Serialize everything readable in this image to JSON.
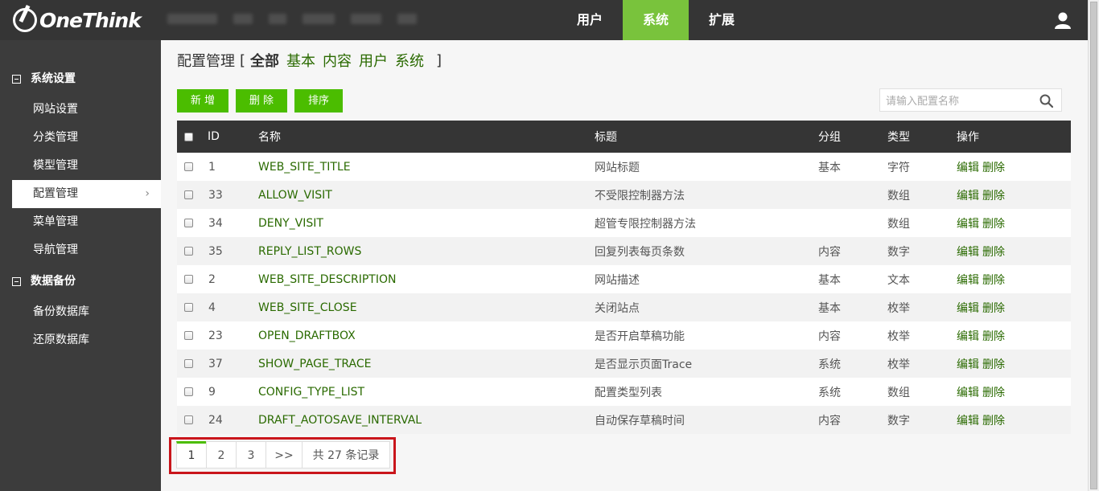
{
  "app": {
    "logo_text": "OneThink",
    "user_icon": "user-icon"
  },
  "top_nav": [
    {
      "label": "用户",
      "active": false
    },
    {
      "label": "系统",
      "active": true
    },
    {
      "label": "扩展",
      "active": false
    }
  ],
  "sidebar": {
    "groups": [
      {
        "title": "系统设置",
        "items": [
          {
            "label": "网站设置",
            "active": false
          },
          {
            "label": "分类管理",
            "active": false
          },
          {
            "label": "模型管理",
            "active": false
          },
          {
            "label": "配置管理",
            "active": true
          },
          {
            "label": "菜单管理",
            "active": false
          },
          {
            "label": "导航管理",
            "active": false
          }
        ]
      },
      {
        "title": "数据备份",
        "items": [
          {
            "label": "备份数据库",
            "active": false
          },
          {
            "label": "还原数据库",
            "active": false
          }
        ]
      }
    ]
  },
  "page": {
    "title": "配置管理",
    "open_bracket": "[",
    "close_bracket": "]",
    "filters": [
      {
        "label": "全部",
        "active": true
      },
      {
        "label": "基本",
        "active": false
      },
      {
        "label": "内容",
        "active": false
      },
      {
        "label": "用户",
        "active": false
      },
      {
        "label": "系统",
        "active": false
      }
    ]
  },
  "toolbar": {
    "add_label": "新 增",
    "delete_label": "删 除",
    "sort_label": "排序",
    "search_placeholder": "请输入配置名称",
    "accent_color": "#4bbd00"
  },
  "table": {
    "headers": {
      "id": "ID",
      "name": "名称",
      "title": "标题",
      "group": "分组",
      "type": "类型",
      "ops": "操作"
    },
    "rows": [
      {
        "id": "1",
        "name": "WEB_SITE_TITLE",
        "title": "网站标题",
        "group": "基本",
        "type": "字符"
      },
      {
        "id": "33",
        "name": "ALLOW_VISIT",
        "title": "不受限控制器方法",
        "group": "",
        "type": "数组"
      },
      {
        "id": "34",
        "name": "DENY_VISIT",
        "title": "超管专限控制器方法",
        "group": "",
        "type": "数组"
      },
      {
        "id": "35",
        "name": "REPLY_LIST_ROWS",
        "title": "回复列表每页条数",
        "group": "内容",
        "type": "数字"
      },
      {
        "id": "2",
        "name": "WEB_SITE_DESCRIPTION",
        "title": "网站描述",
        "group": "基本",
        "type": "文本"
      },
      {
        "id": "4",
        "name": "WEB_SITE_CLOSE",
        "title": "关闭站点",
        "group": "基本",
        "type": "枚举"
      },
      {
        "id": "23",
        "name": "OPEN_DRAFTBOX",
        "title": "是否开启草稿功能",
        "group": "内容",
        "type": "枚举"
      },
      {
        "id": "37",
        "name": "SHOW_PAGE_TRACE",
        "title": "是否显示页面Trace",
        "group": "系统",
        "type": "枚举"
      },
      {
        "id": "9",
        "name": "CONFIG_TYPE_LIST",
        "title": "配置类型列表",
        "group": "系统",
        "type": "数组"
      },
      {
        "id": "24",
        "name": "DRAFT_AOTOSAVE_INTERVAL",
        "title": "自动保存草稿时间",
        "group": "内容",
        "type": "数字"
      }
    ],
    "edit_label": "编辑",
    "delete_label": "删除"
  },
  "pagination": {
    "pages": [
      "1",
      "2",
      "3"
    ],
    "current": "1",
    "next_label": ">>",
    "total_label": "共 27 条记录"
  }
}
